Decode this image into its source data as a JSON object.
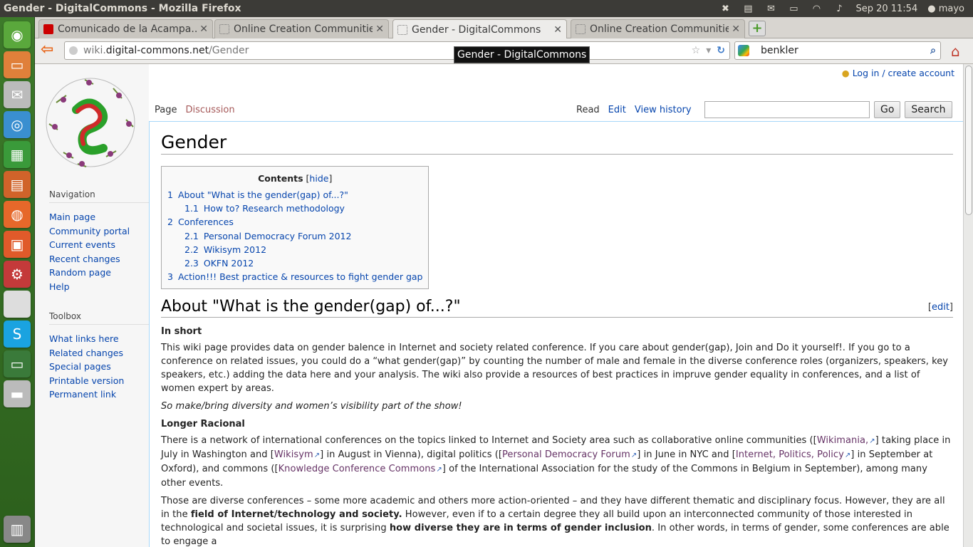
{
  "window": {
    "title": "Gender - DigitalCommons - Mozilla Firefox"
  },
  "panel": {
    "clock": "Sep 20 11:54",
    "user": "mayo"
  },
  "tabs": [
    {
      "label": "Comunicado de la Acampa..."
    },
    {
      "label": "Online Creation Communities"
    },
    {
      "label": "Gender - DigitalCommons"
    },
    {
      "label": "Online Creation Communities"
    }
  ],
  "url": {
    "domain_prefix": "wiki.",
    "domain": "digital-commons.net",
    "path": "/Gender"
  },
  "search": {
    "value": "benkler"
  },
  "tooltip": {
    "text": "Gender - DigitalCommons"
  },
  "wiki": {
    "login": "Log in / create account",
    "page_tabs": {
      "page": "Page",
      "discussion": "Discussion",
      "read": "Read",
      "edit": "Edit",
      "history": "View history"
    },
    "search_go": "Go",
    "search_btn": "Search",
    "navigation": {
      "title": "Navigation",
      "items": [
        "Main page",
        "Community portal",
        "Current events",
        "Recent changes",
        "Random page",
        "Help"
      ]
    },
    "toolbox": {
      "title": "Toolbox",
      "items": [
        "What links here",
        "Related changes",
        "Special pages",
        "Printable version",
        "Permanent link"
      ]
    },
    "heading": "Gender",
    "toc": {
      "title": "Contents",
      "hide": "hide",
      "items": [
        {
          "num": "1",
          "text": "About \"What is the gender(gap) of...?\""
        },
        {
          "num": "1.1",
          "text": "How to? Research methodology"
        },
        {
          "num": "2",
          "text": "Conferences"
        },
        {
          "num": "2.1",
          "text": "Personal Democracy Forum 2012"
        },
        {
          "num": "2.2",
          "text": "Wikisym 2012"
        },
        {
          "num": "2.3",
          "text": "OKFN 2012"
        },
        {
          "num": "3",
          "text": "Action!!! Best practice & resources to fight gender gap"
        }
      ]
    },
    "section1": {
      "title": "About \"What is the gender(gap) of...?\"",
      "edit": "edit",
      "in_short": "In short",
      "p1": "This wiki page provides data on gender balence in Internet and society related conference. If you care about gender(gap), Join and Do it yourself!. If you go to a conference on related issues, you could do a “what gender(gap)” by counting the number of male and female in the diverse conference roles (organizers, speakers, key speakers, etc.) adding the data here and your analysis. The wiki also provide a resources of best practices in impruve gender equality in conferences, and a list of women expert by areas.",
      "p2": "So make/bring diversity and women’s visibility part of the show!",
      "longer": "Longer Racional",
      "p3a": "There is a network of international conferences on the topics linked to Internet and Society area such as collaborative online communities ([",
      "link_wikimania": "Wikimania,",
      "p3b": "] taking place in July in Washington and [",
      "link_wikisym": "Wikisym",
      "p3c": "] in August in Vienna), digital politics ([",
      "link_pdf": "Personal Democracy Forum",
      "p3d": "] in June in NYC and [",
      "link_ipp": "Internet, Politics, Policy",
      "p3e": "] in September at Oxford), and commons ([",
      "link_kcc": "Knowledge Conference Commons",
      "p3f": "] of the International Association for the study of the Commons in Belgium in September), among many other events.",
      "p4a": "Those are diverse conferences – some more academic and others more action-oriented – and they have different thematic and disciplinary focus. However, they are all in the ",
      "p4b": "field of Internet/technology and society.",
      "p4c": " However, even if to a certain degree they all build upon an interconnected community of those interested in technological and societal issues, it is surprising ",
      "p4d": "how diverse they are in terms of gender inclusion",
      "p4e": ". In other words, in terms of gender, some conferences are able to engage a"
    }
  }
}
